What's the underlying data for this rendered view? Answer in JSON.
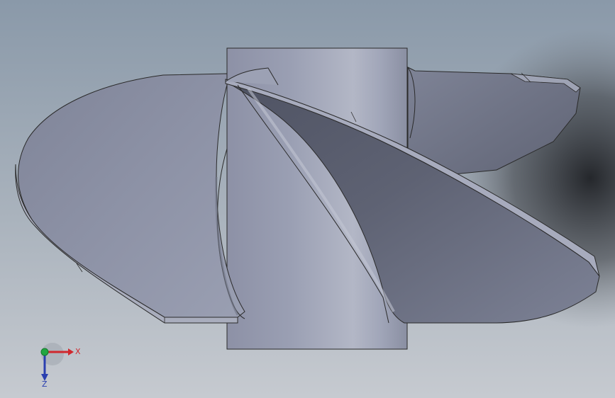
{
  "viewport": {
    "background_top": "#8796a6",
    "background_bottom": "#c3c8cf",
    "model_color": "#8a8fa3",
    "edge_color": "#2a2a2a"
  },
  "model": {
    "name": "propeller-impeller",
    "parts": [
      "hub-cylinder",
      "blade-left",
      "blade-right",
      "blade-back"
    ]
  },
  "triad": {
    "x_label": "X",
    "z_label": "Z",
    "x_color": "#d0282e",
    "y_color": "#22a640",
    "z_color": "#2a3fb0"
  }
}
